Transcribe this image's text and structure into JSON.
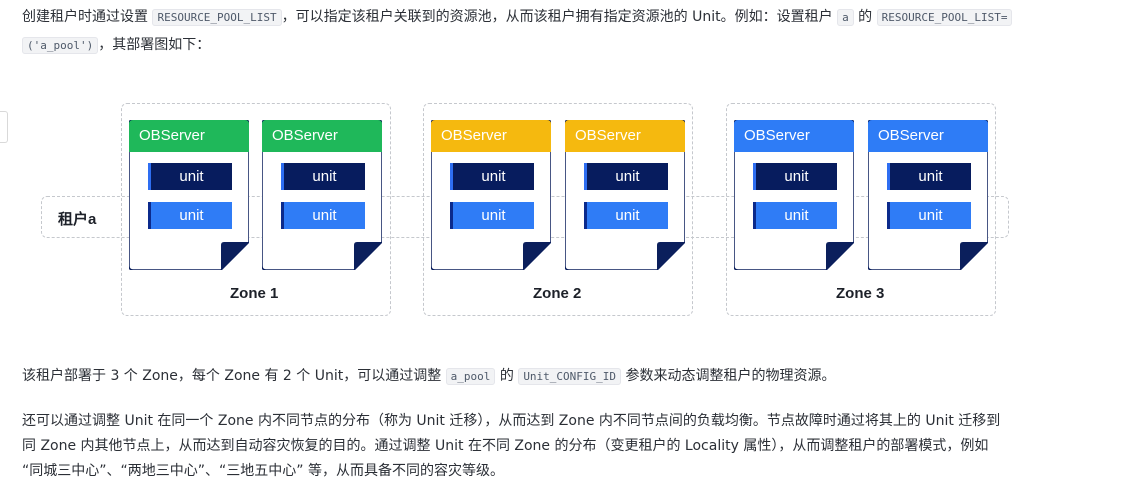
{
  "intro": {
    "t1": "创建租户时通过设置 ",
    "code1": "RESOURCE_POOL_LIST",
    "t2": "，可以指定该租户关联到的资源池，从而该租户拥有指定资源池的 Unit。例如：设置租户 ",
    "code2": "a",
    "t3": " 的 ",
    "code3": "RESOURCE_POOL_LIST=",
    "code4": "('a_pool')",
    "t4": "，其部署图如下："
  },
  "diagram": {
    "tenant_label": "租户a",
    "server_title": "OBServer",
    "unit_label": "unit",
    "zones": [
      {
        "label": "Zone 1",
        "color": "#1fb85a"
      },
      {
        "label": "Zone 2",
        "color": "#f5b90f"
      },
      {
        "label": "Zone 3",
        "color": "#2e7cf6"
      }
    ]
  },
  "para2": {
    "t1": "该租户部署于 3 个 Zone，每个 Zone 有 2 个 Unit，可以通过调整 ",
    "code1": "a_pool",
    "t2": " 的 ",
    "code2": "Unit_CONFIG_ID",
    "t3": " 参数来动态调整租户的物理资源。"
  },
  "para3": {
    "line1": "还可以通过调整 Unit 在同一个 Zone 内不同节点的分布（称为 Unit 迁移），从而达到 Zone 内不同节点间的负载均衡。节点故障时通过将其上的 Unit 迁移到",
    "line2": "同 Zone 内其他节点上，从而达到自动容灾恢复的目的。通过调整 Unit 在不同 Zone 的分布（变更租户的 Locality 属性），从而调整租户的部署模式，例如",
    "line3": "“同城三中心”、“两地三中心”、“三地五中心” 等，从而具备不同的容灾等级。"
  }
}
